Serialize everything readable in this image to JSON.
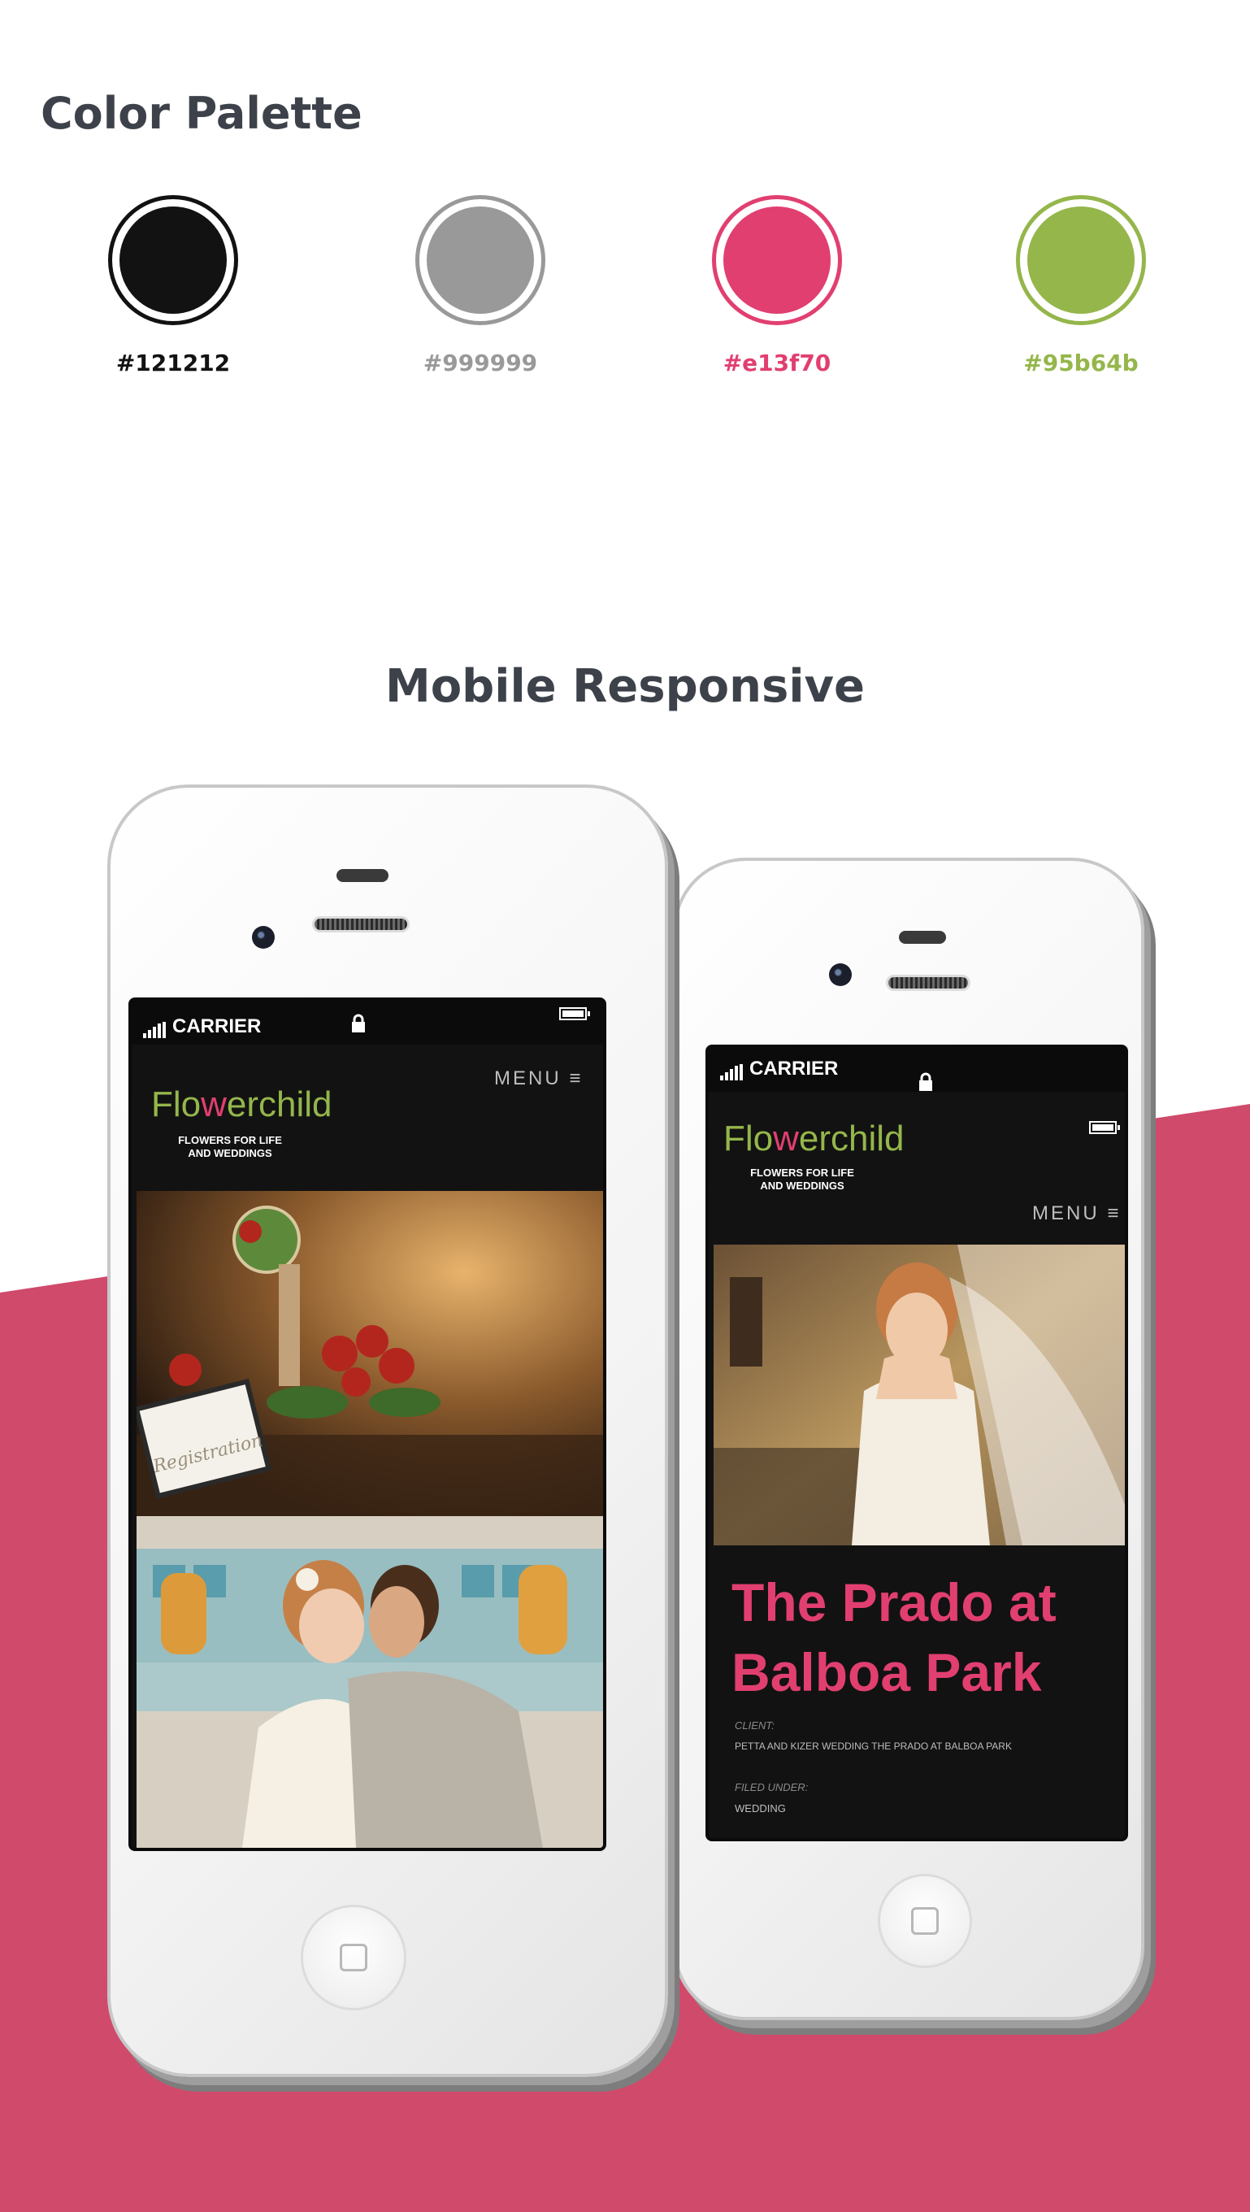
{
  "palette": {
    "title": "Color Palette",
    "swatches": [
      {
        "hex": "#121212",
        "label": "#121212"
      },
      {
        "hex": "#999999",
        "label": "#999999"
      },
      {
        "hex": "#e13f70",
        "label": "#e13f70"
      },
      {
        "hex": "#95b64b",
        "label": "#95b64b"
      }
    ]
  },
  "mobile": {
    "title": "Mobile Responsive",
    "band_color": "#d04a6b",
    "phone_left": {
      "status": {
        "carrier": "CARRIER"
      },
      "logo": {
        "text_before": "Flo",
        "text_after": "erchild",
        "mark": "w"
      },
      "tagline_line1": "FLOWERS FOR LIFE",
      "tagline_line2": "AND WEDDINGS",
      "menu": "MENU ≡",
      "photo1": "registration-table-flowers-photo",
      "photo2": "couple-embracing-photo",
      "photo_sign": "Registration"
    },
    "phone_right": {
      "status": {
        "carrier": "CARRIER"
      },
      "logo": {
        "text_before": "Flo",
        "text_after": "erchild",
        "mark": "w"
      },
      "tagline_line1": "FLOWERS FOR LIFE",
      "tagline_line2": "AND WEDDINGS",
      "menu": "MENU ≡",
      "photo": "bride-with-veil-photo",
      "title_line1": "The Prado at",
      "title_line2": "Balboa Park",
      "client_label": "CLIENT:",
      "client_value": "PETTA AND KIZER WEDDING THE PRADO AT BALBOA PARK",
      "filed_label": "FILED UNDER:",
      "filed_value": "WEDDING"
    }
  }
}
